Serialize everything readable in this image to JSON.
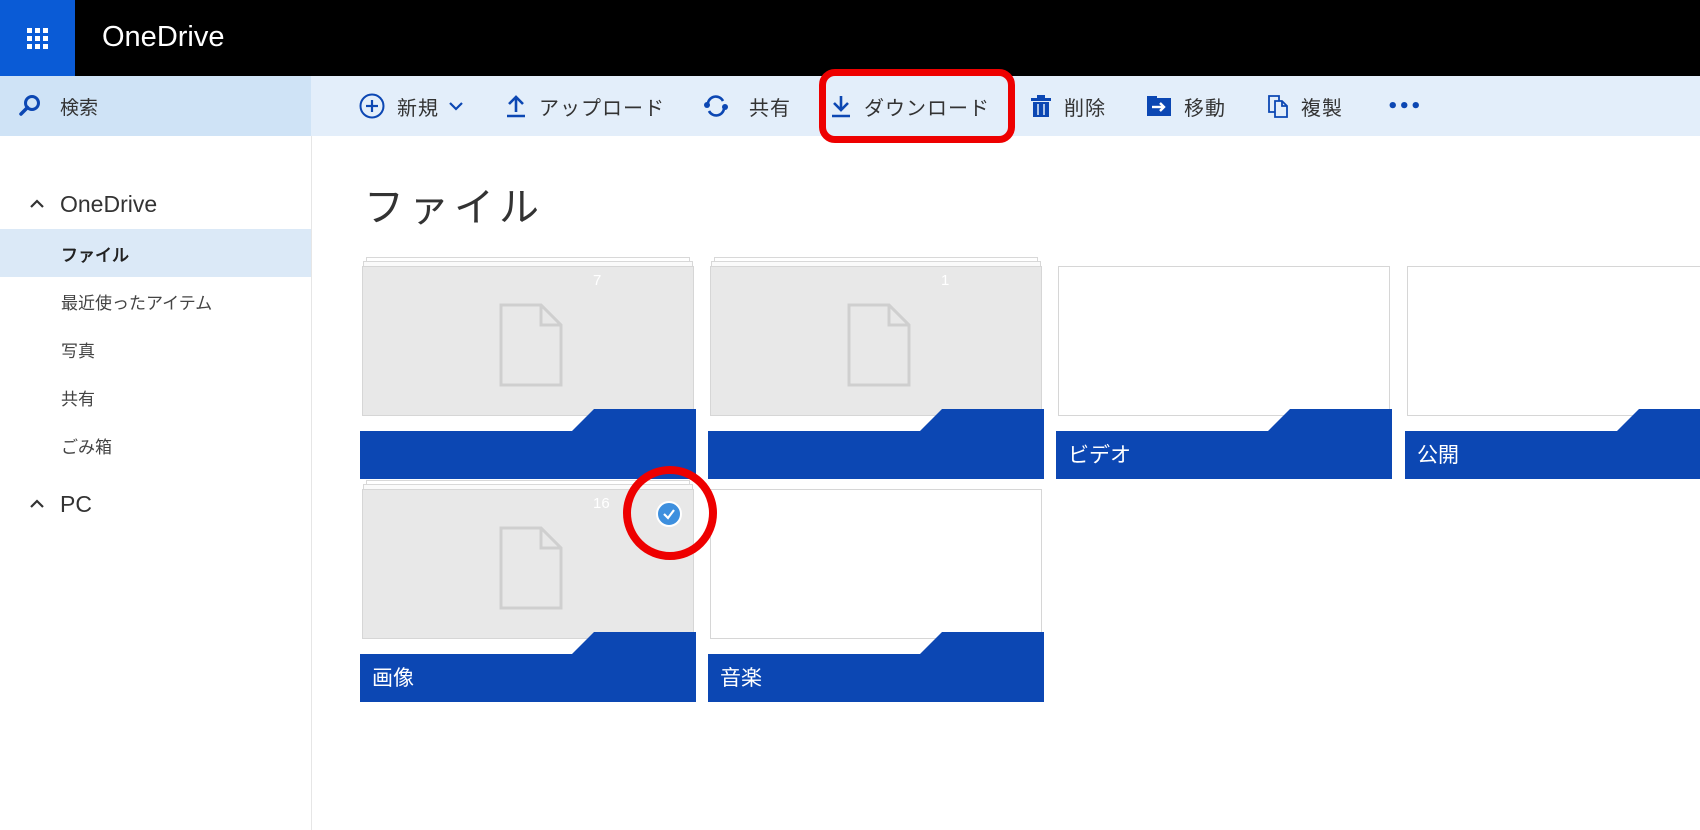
{
  "app": {
    "title": "OneDrive"
  },
  "colors": {
    "accent": "#0a5bd6",
    "band": "#0c47b3",
    "highlight": "#ee0000"
  },
  "search": {
    "label": "検索",
    "icon": "search-icon"
  },
  "toolbar": {
    "new_label": "新規",
    "upload_label": "アップロード",
    "share_label": "共有",
    "download_label": "ダウンロード",
    "delete_label": "削除",
    "move_label": "移動",
    "copy_label": "複製",
    "more_label": "•••"
  },
  "nav": {
    "onedrive_label": "OneDrive",
    "items": [
      {
        "label": "ファイル",
        "active": true
      },
      {
        "label": "最近使ったアイテム"
      },
      {
        "label": "写真"
      },
      {
        "label": "共有"
      },
      {
        "label": "ごみ箱"
      }
    ],
    "pc_label": "PC"
  },
  "main": {
    "title": "ファイル",
    "tiles": [
      {
        "name": "",
        "count": "7"
      },
      {
        "name": "",
        "count": "1"
      },
      {
        "name": "ビデオ",
        "count": "0"
      },
      {
        "name": "公開",
        "count": "0"
      },
      {
        "name": "画像",
        "count": "16",
        "selected": true
      },
      {
        "name": "音楽",
        "count": "0"
      }
    ]
  }
}
